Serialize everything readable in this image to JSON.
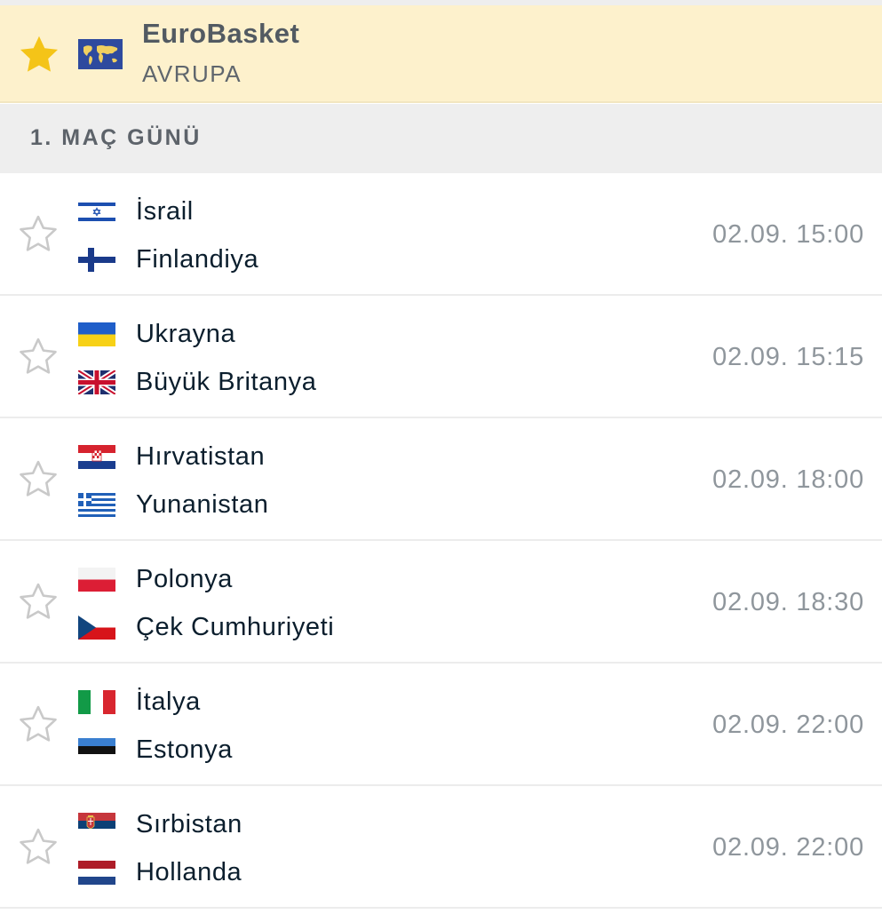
{
  "league": {
    "name": "EuroBasket",
    "region": "AVRUPA",
    "favorite_icon": "star-filled-icon",
    "star_color": "#f4c418"
  },
  "round": {
    "label": "1. MAÇ GÜNÜ"
  },
  "matches": [
    {
      "home": "İsrail",
      "away": "Finlandiya",
      "time": "02.09. 15:00"
    },
    {
      "home": "Ukrayna",
      "away": "Büyük Britanya",
      "time": "02.09. 15:15"
    },
    {
      "home": "Hırvatistan",
      "away": "Yunanistan",
      "time": "02.09. 18:00"
    },
    {
      "home": "Polonya",
      "away": "Çek Cumhuriyeti",
      "time": "02.09. 18:30"
    },
    {
      "home": "İtalya",
      "away": "Estonya",
      "time": "02.09. 22:00"
    },
    {
      "home": "Sırbistan",
      "away": "Hollanda",
      "time": "02.09. 22:00"
    }
  ],
  "colors": {
    "header_bg": "#fdf1cc",
    "round_bg": "#eeeeee",
    "time_text": "#8f969c",
    "team_text": "#0b1e2d"
  }
}
